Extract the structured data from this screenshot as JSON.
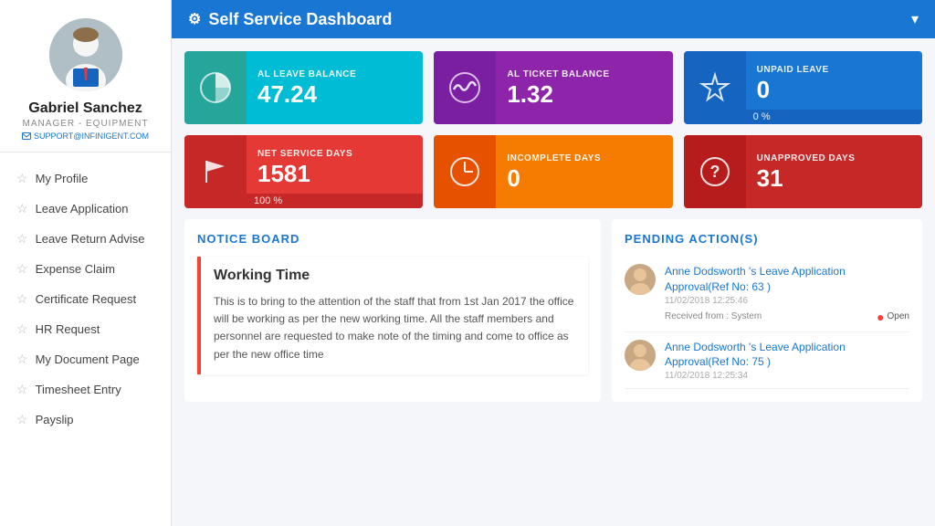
{
  "sidebar": {
    "user": {
      "name": "Gabriel Sanchez",
      "role": "MANAGER - EQUIPMENT",
      "email": "SUPPORT@INFINIGENT.COM"
    },
    "nav": [
      {
        "label": "My Profile"
      },
      {
        "label": "Leave Application"
      },
      {
        "label": "Leave Return Advise"
      },
      {
        "label": "Expense Claim"
      },
      {
        "label": "Certificate Request"
      },
      {
        "label": "HR Request"
      },
      {
        "label": "My Document Page"
      },
      {
        "label": "Timesheet Entry"
      },
      {
        "label": "Payslip"
      }
    ]
  },
  "header": {
    "title": "Self Service Dashboard",
    "icon": "⚙"
  },
  "stats_row1": [
    {
      "id": "al-leave",
      "label": "AL LEAVE BALANCE",
      "value": "47.24",
      "sub": null,
      "card_class": "card-teal"
    },
    {
      "id": "al-ticket",
      "label": "AL TICKET BALANCE",
      "value": "1.32",
      "sub": null,
      "card_class": "card-purple"
    },
    {
      "id": "unpaid",
      "label": "UNPAID LEAVE",
      "value": "0",
      "sub": "0 %",
      "card_class": "card-blue"
    }
  ],
  "stats_row2": [
    {
      "id": "net-service",
      "label": "NET SERVICE DAYS",
      "value": "1581",
      "sub": "100 %",
      "card_class": "card-red"
    },
    {
      "id": "incomplete",
      "label": "INCOMPLETE DAYS",
      "value": "0",
      "sub": null,
      "card_class": "card-orange"
    },
    {
      "id": "unapproved",
      "label": "UNAPPROVED DAYS",
      "value": "31",
      "sub": null,
      "card_class": "card-dark-red"
    }
  ],
  "notice_board": {
    "title": "NOTICE BOARD",
    "notice_title": "Working Time",
    "notice_body": "This is to bring to the attention of the staff that from 1st Jan 2017 the office will be working as per the new working time. All the staff members and personnel are requested to make note of the timing and come to office as per the new office time"
  },
  "pending": {
    "title": "PENDING ACTION(S)",
    "items": [
      {
        "name": "Anne Dodsworth 's Leave Application Approval(Ref No: 63 )",
        "date": "11/02/2018 12:25:46",
        "from": "Received from : System",
        "status": "Open"
      },
      {
        "name": "Anne Dodsworth 's Leave Application Approval(Ref No: 75 )",
        "date": "11/02/2018 12:25:34",
        "from": "",
        "status": ""
      }
    ]
  }
}
